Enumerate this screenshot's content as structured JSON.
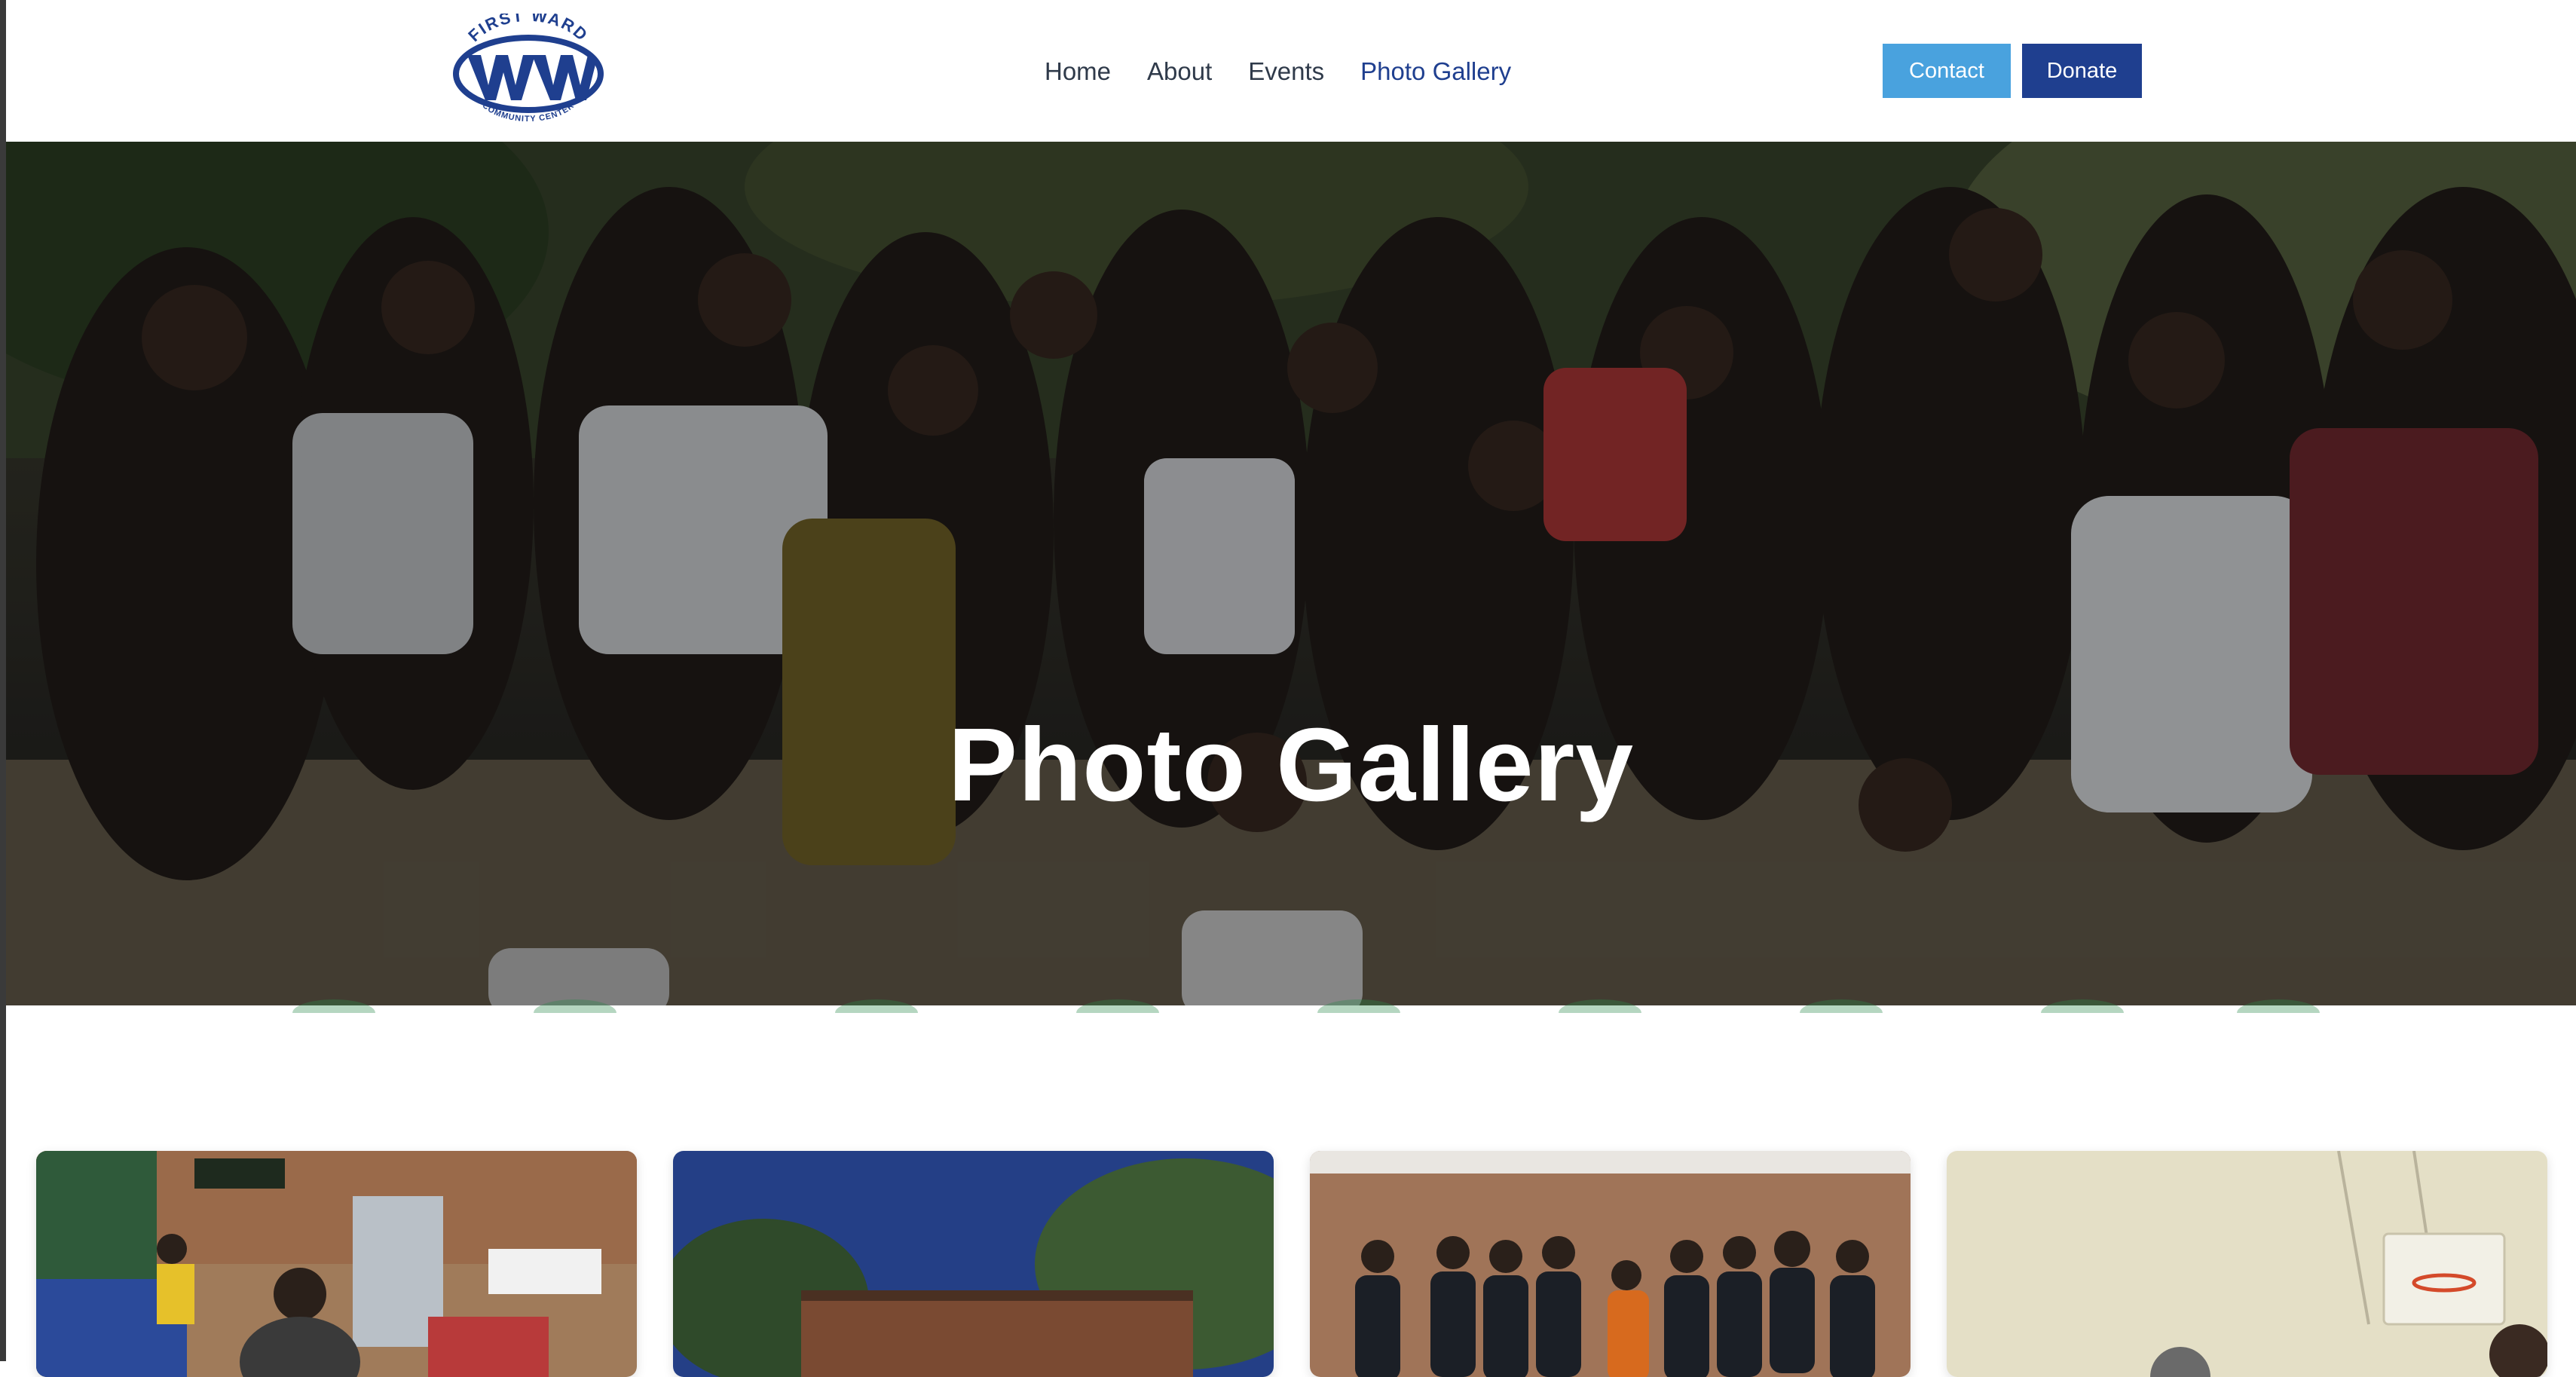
{
  "brand": {
    "logo_alt": "First Ward Community Center",
    "logo_top": "FIRST WARD",
    "logo_bottom": "COMMUNITY CENTER",
    "primary": "#1f3f8f",
    "accent": "#49a2de"
  },
  "nav": {
    "items": [
      {
        "label": "Home",
        "active": false
      },
      {
        "label": "About",
        "active": false
      },
      {
        "label": "Events",
        "active": false
      },
      {
        "label": "Photo Gallery",
        "active": true
      }
    ]
  },
  "actions": {
    "contact_label": "Contact",
    "donate_label": "Donate"
  },
  "hero": {
    "title": "Photo Gallery"
  },
  "gallery": {
    "photos": [
      {
        "description": "college fair in gymnasium"
      },
      {
        "description": "brick building under blue sky"
      },
      {
        "description": "group of students in front of brick wall"
      },
      {
        "description": "basketball hoop in gym"
      }
    ]
  }
}
